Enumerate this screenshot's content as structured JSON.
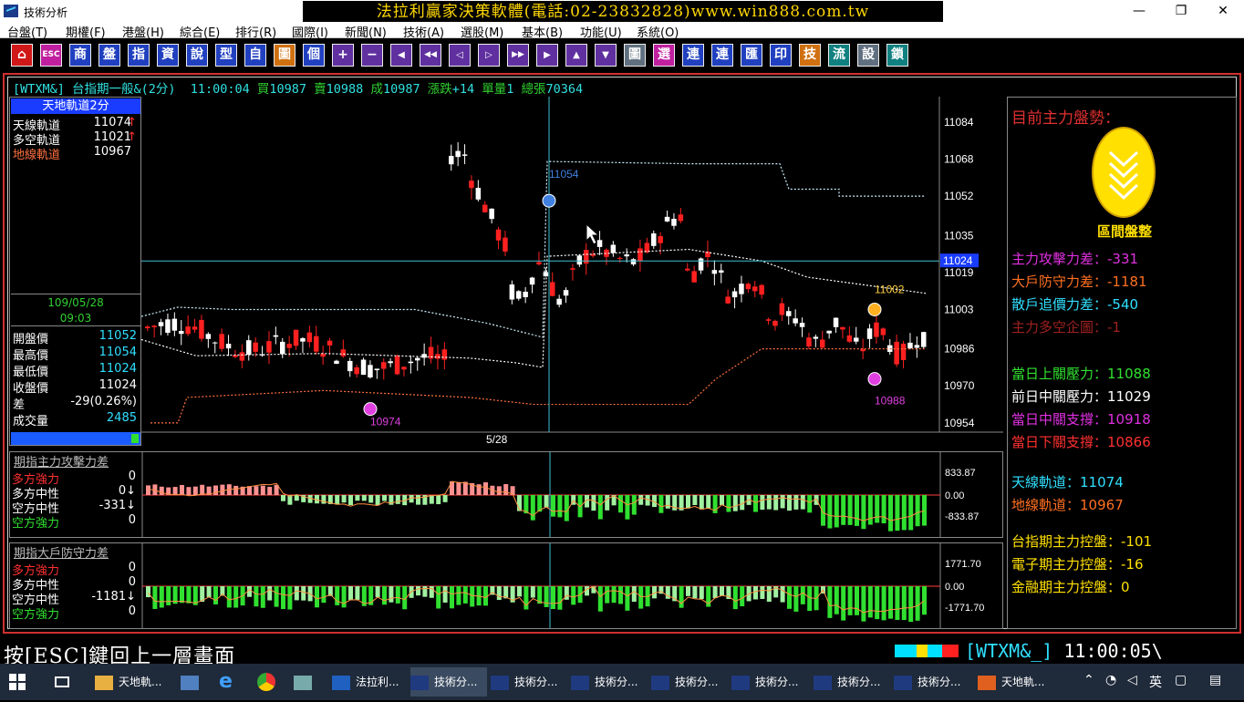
{
  "window": {
    "title": "技術分析",
    "banner": "法拉利贏家決策軟體(電話:02-23832828)www.win888.com.tw",
    "min": "—",
    "max": "❐",
    "close": "✕"
  },
  "menu": [
    "台盤(T)",
    "期權(F)",
    "港盤(H)",
    "綜合(E)",
    "排行(R)",
    "國際(I)",
    "新聞(N)",
    "技術(A)",
    "選股(M)",
    "基本(B)",
    "功能(U)",
    "系統(O)"
  ],
  "toolbar": [
    "⌂",
    "ESC",
    "商",
    "盤",
    "指",
    "資",
    "說",
    "型",
    "自",
    "圖",
    "個",
    "+",
    "−",
    "◀",
    "◀◀",
    "◁",
    "▷",
    "▶▶",
    "▶",
    "▲",
    "▼",
    "圖",
    "選",
    "連",
    "連",
    "匯",
    "印",
    "技",
    "流",
    "設",
    "鎖"
  ],
  "quote": {
    "symbol": "[WTXM&]",
    "name": "台指期一般&(2分)",
    "time": "11:00:04",
    "buy_label": "買",
    "buy": "10987",
    "sell_label": "賣",
    "sell": "10988",
    "deal_label": "成",
    "deal": "10987",
    "chg_label": "漲跌",
    "chg": "+14",
    "vol_label": "單量",
    "vol": "1",
    "total_label": "總張",
    "total": "70364"
  },
  "left_panel": {
    "title": "天地軌道2分",
    "rows": [
      {
        "k": "天線軌道",
        "v": "11074",
        "mark": "↑",
        "kc": "#ffffff"
      },
      {
        "k": "多空軌道",
        "v": "11021",
        "mark": "↑",
        "kc": "#ffffff"
      },
      {
        "k": "地線軌道",
        "v": "10967",
        "mark": "",
        "kc": "#ff7040"
      }
    ],
    "date": "109/05/28",
    "time": "09:03",
    "stats": [
      {
        "k": "開盤價",
        "v": "11052",
        "vc": "#30e0ff"
      },
      {
        "k": "最高價",
        "v": "11054",
        "vc": "#30e0ff"
      },
      {
        "k": "最低價",
        "v": "11024",
        "vc": "#30e0ff"
      },
      {
        "k": "收盤價",
        "v": "11024",
        "vc": "#ffffff"
      },
      {
        "k": "差",
        "v": "-29(0.26%)",
        "vc": "#ffffff"
      },
      {
        "k": "成交量",
        "v": "2485",
        "vc": "#30e0ff"
      }
    ]
  },
  "main_chart": {
    "y_ticks": [
      "11084",
      "11068",
      "11052",
      "11035",
      "11019",
      "11003",
      "10986",
      "10970",
      "10954"
    ],
    "crosshair_price": "11024",
    "date_label": "5/28",
    "annotations": {
      "top": "11054",
      "low1": "10974",
      "high2": "11002",
      "low2": "10988"
    }
  },
  "sub1": {
    "title": "期指主力攻擊力差",
    "rows": [
      {
        "k": "多方強力",
        "v": "0",
        "kc": "#ff3030"
      },
      {
        "k": "多方中性",
        "v": "0↓",
        "kc": "#ffffff"
      },
      {
        "k": "空方中性",
        "v": "-331↓",
        "kc": "#ffffff"
      },
      {
        "k": "空方強力",
        "v": "0",
        "kc": "#30e030"
      }
    ],
    "ticks": [
      "833.87",
      "0.00",
      "-833.87"
    ]
  },
  "sub2": {
    "title": "期指大戶防守力差",
    "rows": [
      {
        "k": "多方強力",
        "v": "0",
        "kc": "#ff3030"
      },
      {
        "k": "多方中性",
        "v": "0",
        "kc": "#ffffff"
      },
      {
        "k": "空方中性",
        "v": "-1181↓",
        "kc": "#ffffff"
      },
      {
        "k": "空方強力",
        "v": "0",
        "kc": "#30e030"
      }
    ],
    "ticks": [
      "1771.70",
      "0.00",
      "-1771.70"
    ]
  },
  "right_panel": {
    "title": "目前主力盤勢：",
    "medal_label": "區間盤整",
    "rows": [
      {
        "k": "主力攻擊力差：",
        "v": "-331",
        "c": "#e030e0"
      },
      {
        "k": "大戶防守力差：",
        "v": "-1181",
        "c": "#ff7020"
      },
      {
        "k": "散戶追價力差：",
        "v": "-540",
        "c": "#30e0ff"
      },
      {
        "k": "主力多空企圖：",
        "v": "-1",
        "c": "#a02020"
      },
      {
        "k": "當日上關壓力：",
        "v": "11088",
        "c": "#30e030"
      },
      {
        "k": "前日中關壓力：",
        "v": "11029",
        "c": "#ffffff"
      },
      {
        "k": "當日中關支撐：",
        "v": "10918",
        "c": "#e030e0"
      },
      {
        "k": "當日下關支撐：",
        "v": "10866",
        "c": "#ff3030"
      },
      {
        "k": "天線軌道：",
        "v": "11074",
        "c": "#30e0ff"
      },
      {
        "k": "地線軌道：",
        "v": "10967",
        "c": "#ff7020"
      },
      {
        "k": "台指期主力控盤：",
        "v": "-101",
        "c": "#ffe000"
      },
      {
        "k": "電子期主力控盤：",
        "v": "-16",
        "c": "#ffe000"
      },
      {
        "k": "金融期主力控盤：",
        "v": "0",
        "c": "#ffe000"
      }
    ]
  },
  "status": {
    "text": "按[ESC]鍵回上一層畫面",
    "symbol": "[WTXM&_]",
    "time": "11:00:05\\"
  },
  "taskbar": {
    "items": [
      "天地軌...",
      "法拉利...",
      "技術分...",
      "技術分...",
      "技術分...",
      "技術分...",
      "技術分...",
      "技術分...",
      "技術分...",
      "天地軌..."
    ],
    "lang": "英"
  },
  "chart_data": {
    "type": "candlestick",
    "y_range": [
      10950,
      11095
    ],
    "bands": {
      "upper_dotted": "cyan",
      "lower_dotted": "orange",
      "mid_dotted": "white"
    }
  }
}
